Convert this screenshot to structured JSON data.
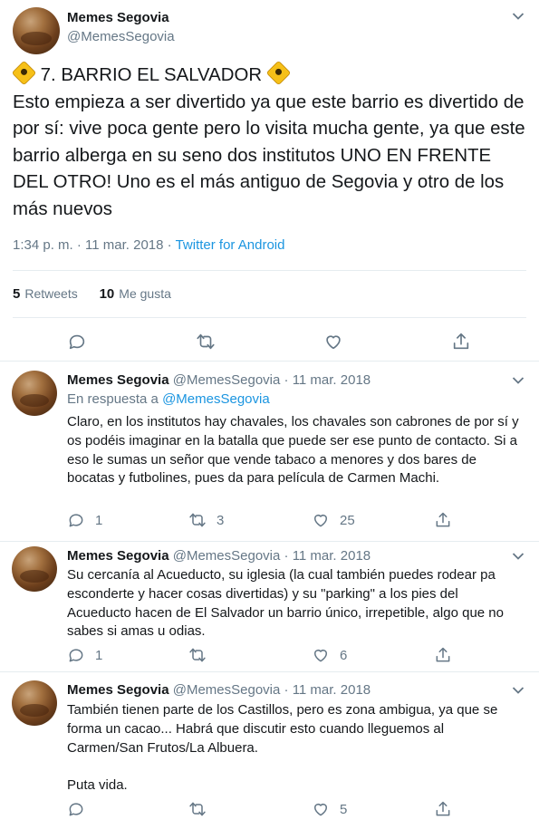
{
  "main_tweet": {
    "author_name": "Memes Segovia",
    "author_handle": "@MemesSegovia",
    "title": "7. BARRIO EL SALVADOR",
    "text": "Esto empieza a ser divertido ya que este barrio es divertido de por sí: vive poca gente pero lo visita mucha gente, ya que este barrio alberga en su seno dos institutos UNO EN FRENTE DEL OTRO! Uno es el más antiguo de Segovia y otro de los más nuevos",
    "time": "1:34 p. m.",
    "date": "11 mar. 2018",
    "source": "Twitter for Android",
    "separator": "·",
    "retweets_count": "5",
    "retweets_label": "Retweets",
    "likes_count": "10",
    "likes_label": "Me gusta"
  },
  "replies": [
    {
      "name": "Memes Segovia",
      "handle": "@MemesSegovia",
      "date": "11 mar. 2018",
      "in_reply_prefix": "En respuesta a",
      "in_reply_mention": "@MemesSegovia",
      "text": "Claro, en los institutos hay chavales, los chavales son cabrones de por sí y os podéis imaginar en la batalla que puede ser ese punto de contacto. Si a eso le sumas un señor que vende tabaco a menores y dos bares de bocatas y futbolines, pues da para película de Carmen Machi.",
      "replies": "1",
      "retweets": "3",
      "likes": "25"
    },
    {
      "name": "Memes Segovia",
      "handle": "@MemesSegovia",
      "date": "11 mar. 2018",
      "text": "Su cercanía al Acueducto, su iglesia (la cual también puedes rodear pa esconderte y hacer cosas divertidas) y su \"parking\" a los pies del Acueducto hacen de El Salvador un barrio único, irrepetible, algo que no sabes si amas u odias.",
      "replies": "1",
      "retweets": "",
      "likes": "6"
    },
    {
      "name": "Memes Segovia",
      "handle": "@MemesSegovia",
      "date": "11 mar. 2018",
      "text": "También tienen parte de los Castillos, pero es zona ambigua, ya que se forma un cacao... Habrá que discutir esto cuando lleguemos al Carmen/San Frutos/La Albuera.",
      "text2": "Puta vida.",
      "replies": "",
      "retweets": "",
      "likes": "5"
    }
  ],
  "colors": {
    "text": "#14171a",
    "secondary": "#657786",
    "link": "#1b95e0",
    "border": "#e6ecf0"
  },
  "icons": [
    "reply-icon",
    "retweet-icon",
    "like-icon",
    "share-icon",
    "chevron-down-icon",
    "warning-sign-emoji"
  ]
}
